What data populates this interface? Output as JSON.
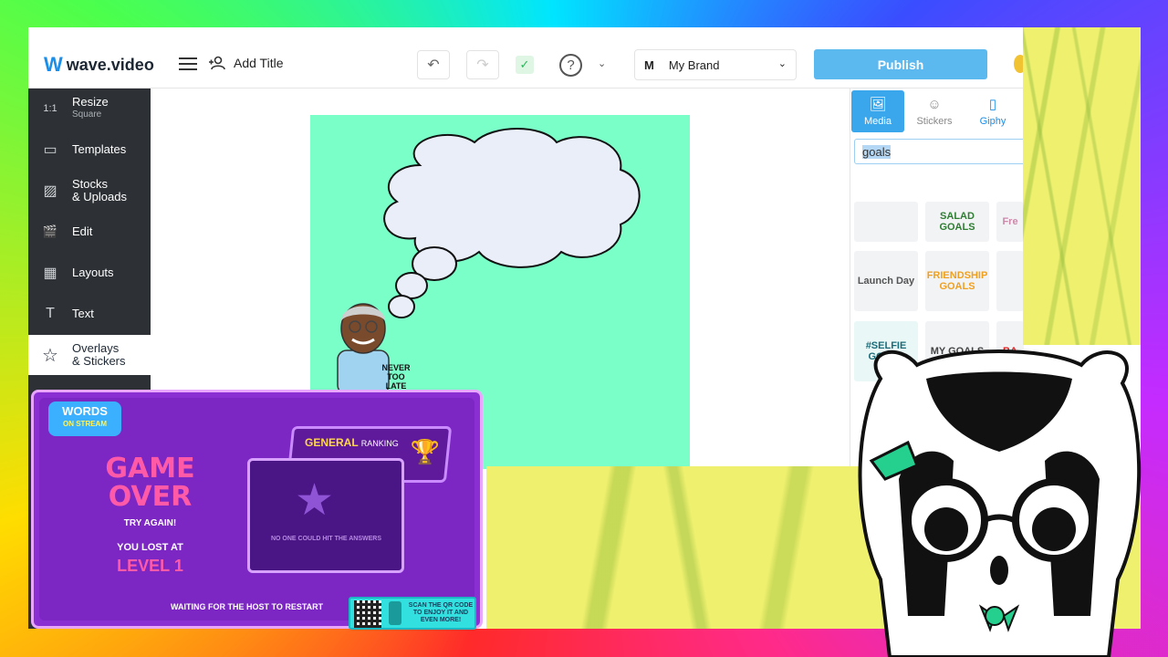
{
  "app": {
    "logo": "wave.video",
    "add_title": "Add Title"
  },
  "toolbar": {
    "brand_initial": "M",
    "brand_name": "My Brand",
    "publish_label": "Publish",
    "help_label": "?"
  },
  "sidebar": {
    "items": [
      {
        "label": "Resize",
        "sub": "Square",
        "icon": "1:1"
      },
      {
        "label": "Templates",
        "sub": "",
        "icon": "▭"
      },
      {
        "label": "Stocks",
        "sub": "& Uploads",
        "icon": "▨"
      },
      {
        "label": "Edit",
        "sub": "",
        "icon": "🎬"
      },
      {
        "label": "Layouts",
        "sub": "",
        "icon": "▦"
      },
      {
        "label": "Text",
        "sub": "",
        "icon": "T"
      },
      {
        "label": "Overlays",
        "sub": "& Stickers",
        "icon": "☆"
      }
    ]
  },
  "canvas": {
    "shirt_text": "NEVER TOO LATE"
  },
  "panel": {
    "tabs": [
      {
        "label": "Media",
        "icon": "🖼"
      },
      {
        "label": "Stickers",
        "icon": "☺"
      },
      {
        "label": "Giphy",
        "icon": "▯"
      }
    ],
    "search_value": "goals",
    "stickers": [
      "",
      "SALAD GOALS",
      "Fre",
      "Launch Day",
      "FRIENDSHIP GOALS",
      "",
      "#SELFIE GOALS",
      "MY GOALS",
      "BA"
    ]
  },
  "game_overlay": {
    "logo_top": "WORDS",
    "logo_bottom": "ON STREAM",
    "title_line1": "GAME",
    "title_line2": "OVER",
    "try_again": "TRY AGAIN!",
    "lost_at": "YOU LOST AT",
    "level": "LEVEL 1",
    "ranking_strong": "GENERAL",
    "ranking_rest": "RANKING",
    "no_hit": "NO ONE COULD HIT THE ANSWERS",
    "waiting": "WAITING FOR THE HOST TO RESTART",
    "qr_text": "SCAN THE QR CODE TO ENJOY IT AND EVEN MORE!"
  },
  "colors": {
    "accent": "#3aa6ec",
    "publish": "#5bb9f0",
    "canvas_bg": "#7affc8",
    "sidebar_bg": "#2d3135",
    "game_purple": "#7c27c4",
    "game_pink": "#ff5aa8"
  }
}
